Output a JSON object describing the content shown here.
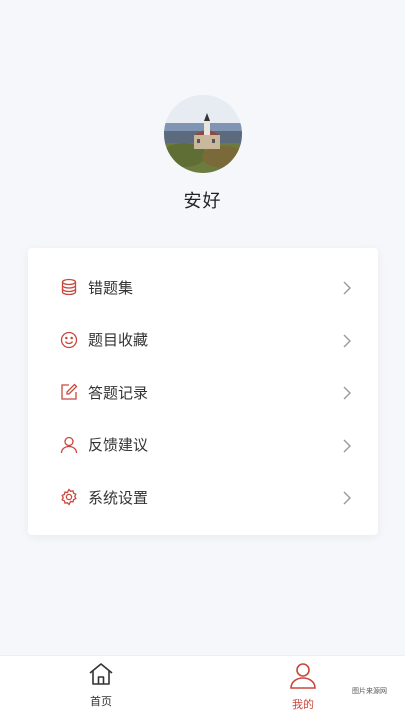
{
  "profile": {
    "username": "安好",
    "avatar_icon": "avatar-photo"
  },
  "menu": {
    "items": [
      {
        "label": "错题集",
        "icon": "database-icon"
      },
      {
        "label": "题目收藏",
        "icon": "smile-icon"
      },
      {
        "label": "答题记录",
        "icon": "edit-icon"
      },
      {
        "label": "反馈建议",
        "icon": "user-icon"
      },
      {
        "label": "系统设置",
        "icon": "gear-icon"
      }
    ]
  },
  "tabbar": {
    "home_label": "首页",
    "mine_label": "我的",
    "active": "mine"
  },
  "watermark": "图片来源网",
  "colors": {
    "accent": "#c9473d",
    "background": "#f6f7fb",
    "card": "#ffffff",
    "chevron": "#999999"
  }
}
